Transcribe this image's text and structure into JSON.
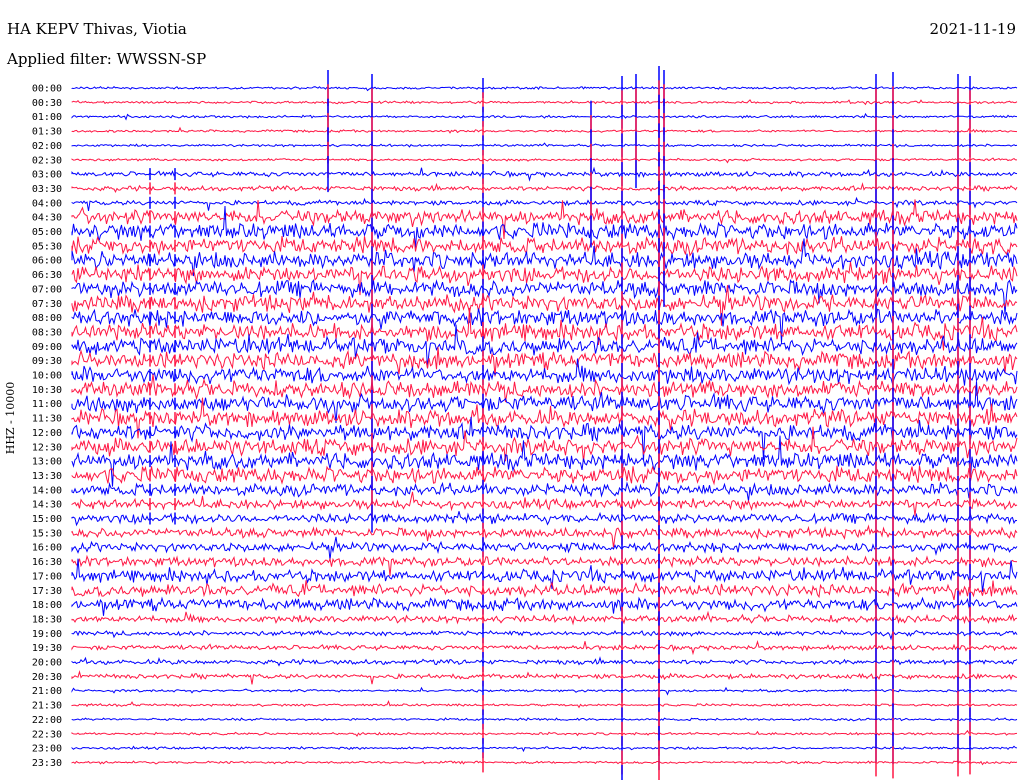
{
  "header": {
    "station": "HA KEPV Thivas, Viotia",
    "filter": "Applied filter: WWSSN-SP",
    "date": "2021-11-19"
  },
  "channel_label": "HHZ - 10000",
  "colors": {
    "blue": "#0000ff",
    "red": "#ff1744"
  },
  "chart_data": {
    "type": "line",
    "title": "HA KEPV Thivas, Viotia",
    "subtitle": "Applied filter: WWSSN-SP",
    "ylabel": "HHZ - 10000",
    "row_labels": [
      "00:00",
      "00:30",
      "01:00",
      "01:30",
      "02:00",
      "02:30",
      "03:00",
      "03:30",
      "04:00",
      "04:30",
      "05:00",
      "05:30",
      "06:00",
      "06:30",
      "07:00",
      "07:30",
      "08:00",
      "08:30",
      "09:00",
      "09:30",
      "10:00",
      "10:30",
      "11:00",
      "11:30",
      "12:00",
      "12:30",
      "13:00",
      "13:30",
      "14:00",
      "14:30",
      "15:00",
      "15:30",
      "16:00",
      "16:30",
      "17:00",
      "17:30",
      "18:00",
      "18:30",
      "19:00",
      "19:30",
      "20:00",
      "20:30",
      "21:00",
      "21:30",
      "22:00",
      "22:30",
      "23:00",
      "23:30"
    ],
    "row_colors": [
      "blue",
      "red"
    ],
    "noise_level": [
      1,
      1,
      1,
      1,
      1,
      1,
      2,
      2,
      2,
      6,
      7,
      7,
      7,
      7,
      7,
      7,
      7,
      7,
      7,
      7,
      7,
      7,
      7,
      7,
      7,
      7,
      7,
      7,
      5,
      4,
      4,
      4,
      4,
      4,
      5,
      5,
      5,
      3,
      2,
      2,
      2,
      2,
      1,
      1,
      1,
      1,
      1,
      1
    ],
    "grid": false
  }
}
